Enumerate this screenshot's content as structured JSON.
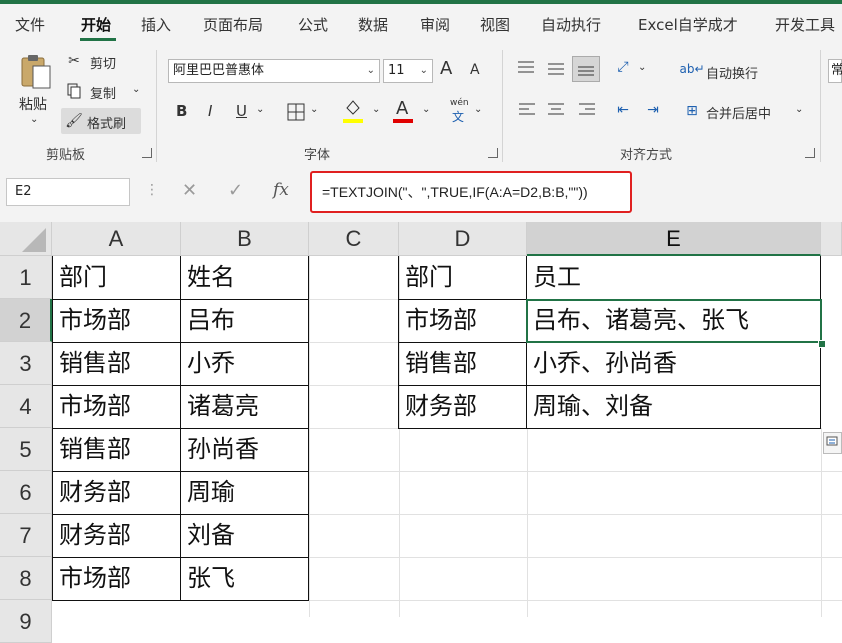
{
  "tabs": [
    "文件",
    "开始",
    "插入",
    "页面布局",
    "公式",
    "数据",
    "审阅",
    "视图",
    "自动执行",
    "Excel自学成才",
    "开发工具"
  ],
  "active_tab": "开始",
  "ribbon": {
    "clipboard": {
      "paste": "粘贴",
      "cut": "剪切",
      "copy": "复制",
      "format_painter": "格式刷",
      "label": "剪贴板"
    },
    "font": {
      "name": "阿里巴巴普惠体",
      "size": "11",
      "grow": "A",
      "shrink": "A",
      "bold": "B",
      "italic": "I",
      "underline": "U",
      "phonetic_top": "wén",
      "phonetic_bottom": "文",
      "font_color_glyph": "A",
      "label": "字体"
    },
    "alignment": {
      "wrap_text": "自动换行",
      "merge_center": "合并后居中",
      "label": "对齐方式",
      "number_fragment": "常"
    },
    "colors": {
      "accent": "#217346",
      "highlight_yellow": "#ffff00",
      "font_red": "#e00000",
      "annotation_red": "#e02020"
    }
  },
  "formula_bar": {
    "name_box": "E2",
    "cancel": "✕",
    "enter": "✓",
    "fx": "fx",
    "formula": "=TEXTJOIN(\"、\",TRUE,IF(A:A=D2,B:B,\"\"))"
  },
  "sheet": {
    "columns": [
      "A",
      "B",
      "C",
      "D",
      "E"
    ],
    "selected_column": "E",
    "rows": [
      "1",
      "2",
      "3",
      "4",
      "5",
      "6",
      "7",
      "8",
      "9"
    ],
    "selected_row": "2",
    "active_cell": "E2",
    "table1": [
      [
        "部门",
        "姓名"
      ],
      [
        "市场部",
        "吕布"
      ],
      [
        "销售部",
        "小乔"
      ],
      [
        "市场部",
        "诸葛亮"
      ],
      [
        "销售部",
        "孙尚香"
      ],
      [
        "财务部",
        "周瑜"
      ],
      [
        "财务部",
        "刘备"
      ],
      [
        "市场部",
        "张飞"
      ]
    ],
    "table2": [
      [
        "部门",
        "员工"
      ],
      [
        "市场部",
        "吕布、诸葛亮、张飞"
      ],
      [
        "销售部",
        "小乔、孙尚香"
      ],
      [
        "财务部",
        "周瑜、刘备"
      ]
    ]
  }
}
